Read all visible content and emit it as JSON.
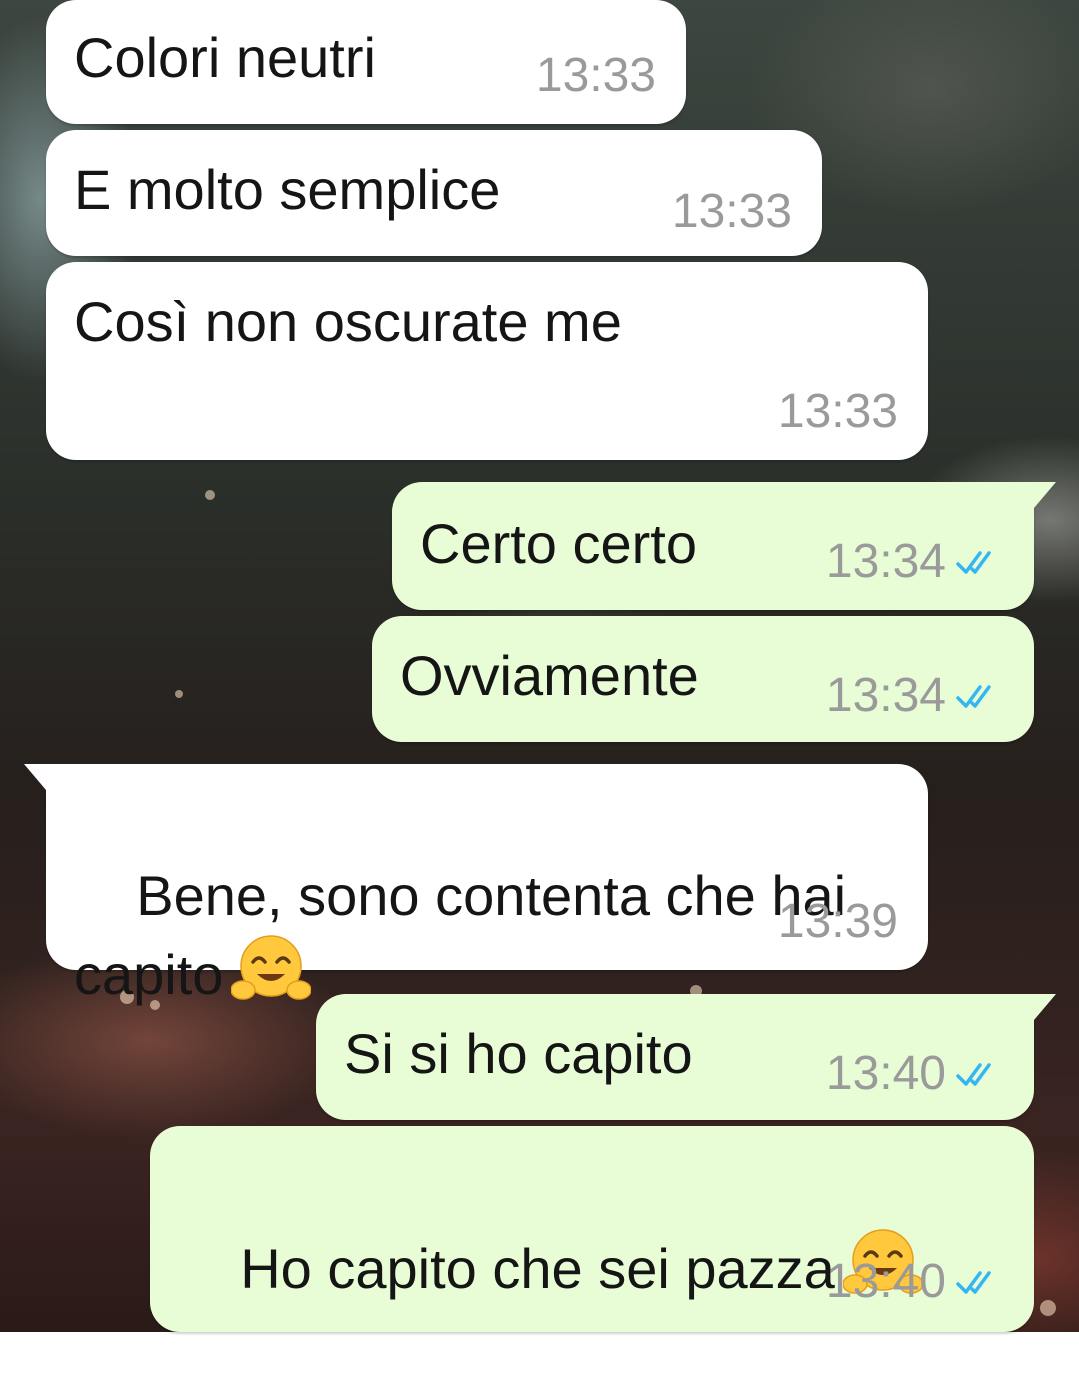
{
  "chat": {
    "messages": [
      {
        "direction": "in",
        "text": "Colori neutri",
        "time": "13:33",
        "emoji": null
      },
      {
        "direction": "in",
        "text": "E molto semplice",
        "time": "13:33",
        "emoji": null
      },
      {
        "direction": "in",
        "text": "Così non oscurate me",
        "time": "13:33",
        "emoji": null
      },
      {
        "direction": "out",
        "text": "Certo certo",
        "time": "13:34",
        "status": "read-ticks-icon"
      },
      {
        "direction": "out",
        "text": "Ovviamente",
        "time": "13:34",
        "status": "read-ticks-icon"
      },
      {
        "direction": "in",
        "text": "Bene, sono contenta che hai\ncapito",
        "time": "13:39",
        "emoji": "hugging-face-emoji"
      },
      {
        "direction": "out",
        "text": "Si si ho capito",
        "time": "13:40",
        "status": "read-ticks-icon"
      },
      {
        "direction": "out",
        "text": "Ho capito che sei pazza",
        "time": "13:40",
        "status": "read-ticks-icon",
        "emoji": "hugging-face-emoji"
      }
    ]
  },
  "colors": {
    "incoming_bubble": "#ffffff",
    "outgoing_bubble": "#e8fdd6",
    "timestamp": "#9a9a9a",
    "read_ticks": "#34b7f1"
  }
}
